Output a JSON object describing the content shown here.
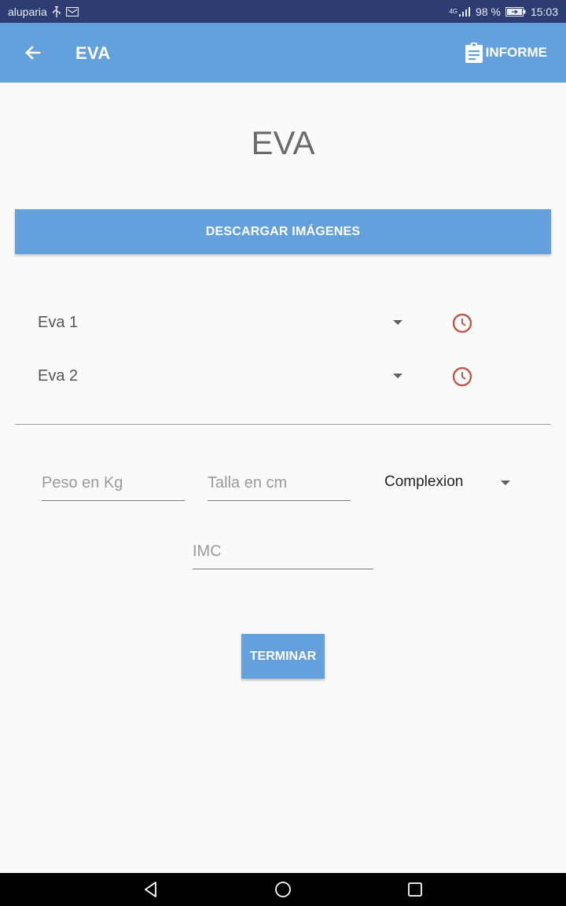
{
  "status_bar": {
    "carrier": "aluparia",
    "signal": "4G",
    "battery": "98 %",
    "time": "15:03"
  },
  "app_bar": {
    "title": "EVA",
    "informe_label": "INFORME",
    "back_icon": "arrow-left-icon",
    "informe_icon": "clipboard-icon"
  },
  "main": {
    "heading": "EVA",
    "download_label": "DESCARGAR IMÁGENES",
    "eva_rows": [
      {
        "label": "Eva 1"
      },
      {
        "label": "Eva 2"
      }
    ],
    "weight": {
      "placeholder": "Peso en Kg",
      "value": ""
    },
    "height": {
      "placeholder": "Talla en cm",
      "value": ""
    },
    "complexion": {
      "label": "Complexion"
    },
    "imc": {
      "placeholder": "IMC",
      "value": ""
    },
    "finish_label": "TERMINAR"
  },
  "colors": {
    "primary": "#64a0dc",
    "status_bar": "#2d3c73",
    "clock": "#c0584a",
    "background": "#fafafa"
  }
}
